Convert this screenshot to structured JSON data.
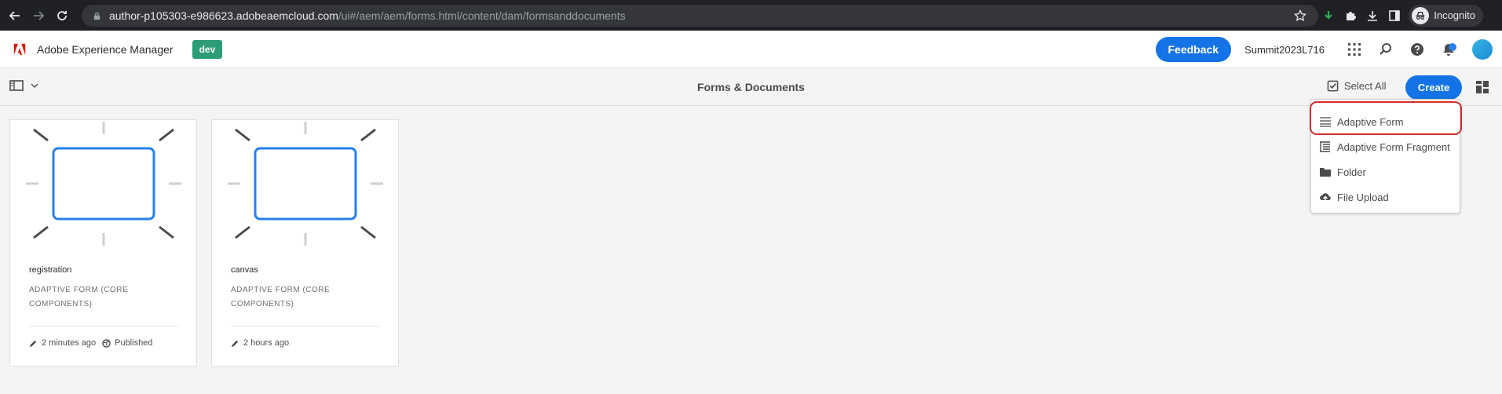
{
  "browser": {
    "url_host": "author-p105303-e986623.adobeaemcloud.com",
    "url_path": "/ui#/aem/aem/forms.html/content/dam/formsanddocuments",
    "profile_label": "Incognito"
  },
  "header": {
    "app_name": "Adobe Experience Manager",
    "env_badge": "dev",
    "feedback_label": "Feedback",
    "user_name": "Summit2023L716"
  },
  "actionbar": {
    "title": "Forms & Documents",
    "select_all_label": "Select All",
    "create_label": "Create"
  },
  "cards": [
    {
      "title": "registration",
      "subtitle": "ADAPTIVE FORM (CORE COMPONENTS)",
      "modified": "2 minutes ago",
      "status": "Published"
    },
    {
      "title": "canvas",
      "subtitle": "ADAPTIVE FORM (CORE COMPONENTS)",
      "modified": "2 hours ago"
    }
  ],
  "create_menu": {
    "items": [
      {
        "label": "Adaptive Form",
        "icon": "adaptive-form-icon"
      },
      {
        "label": "Adaptive Form Fragment",
        "icon": "fragment-icon"
      },
      {
        "label": "Folder",
        "icon": "folder-icon"
      },
      {
        "label": "File Upload",
        "icon": "cloud-upload-icon"
      }
    ],
    "highlighted_item": "Adaptive Form"
  },
  "colors": {
    "accent_blue": "#1473e6",
    "env_badge_green": "#2d9d78",
    "highlight_red": "#d62c2c",
    "thumb_border_blue": "#2680eb"
  }
}
